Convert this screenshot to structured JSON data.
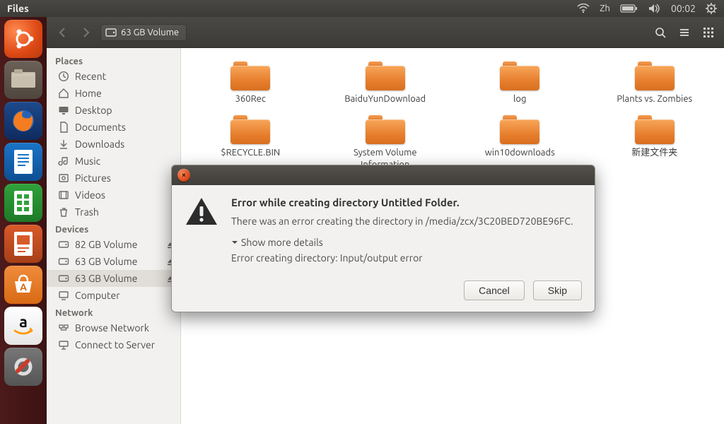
{
  "top_panel": {
    "app_title": "Files",
    "ime": "Zh",
    "clock": "00:02"
  },
  "toolbar": {
    "path_label": "63 GB Volume"
  },
  "sidebar": {
    "places_head": "Places",
    "places": [
      {
        "icon": "recent",
        "label": "Recent"
      },
      {
        "icon": "home",
        "label": "Home"
      },
      {
        "icon": "desktop",
        "label": "Desktop"
      },
      {
        "icon": "doc",
        "label": "Documents"
      },
      {
        "icon": "download",
        "label": "Downloads"
      },
      {
        "icon": "music",
        "label": "Music"
      },
      {
        "icon": "pictures",
        "label": "Pictures"
      },
      {
        "icon": "videos",
        "label": "Videos"
      },
      {
        "icon": "trash",
        "label": "Trash"
      }
    ],
    "devices_head": "Devices",
    "devices": [
      {
        "icon": "drive",
        "label": "82 GB Volume",
        "eject": true
      },
      {
        "icon": "drive",
        "label": "63 GB Volume",
        "eject": true
      },
      {
        "icon": "drive",
        "label": "63 GB Volume",
        "eject": true,
        "selected": true
      },
      {
        "icon": "computer",
        "label": "Computer"
      }
    ],
    "network_head": "Network",
    "network": [
      {
        "icon": "browse",
        "label": "Browse Network"
      },
      {
        "icon": "connect",
        "label": "Connect to Server"
      }
    ]
  },
  "folders": [
    "360Rec",
    "BaiduYunDownload",
    "log",
    "Plants vs. Zombies",
    "$RECYCLE.BIN",
    "System Volume Information",
    "win10downloads",
    "新建文件夹"
  ],
  "dialog": {
    "title": "Error while creating directory Untitled Folder.",
    "message": "There was an error creating the directory in /media/zcx/3C20BED720BE96FC.",
    "details_toggle": "Show more details",
    "detail_line": "Error creating directory: Input/output error",
    "cancel": "Cancel",
    "skip": "Skip"
  }
}
